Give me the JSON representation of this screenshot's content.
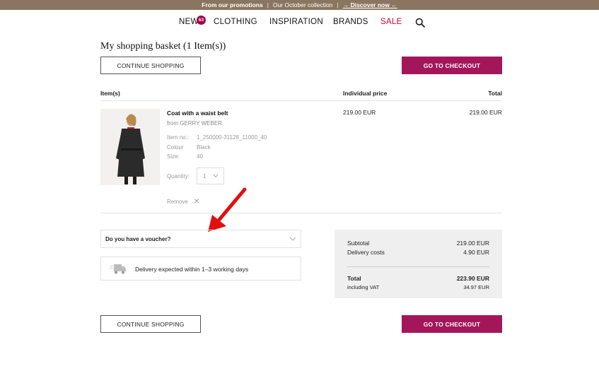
{
  "promo": {
    "part1": "From our promotions",
    "sep1": "|",
    "part2": "Our October collection",
    "sep2": "|",
    "link": "→ Discover now ←"
  },
  "nav": {
    "items": [
      {
        "label": "NEW"
      },
      {
        "label": "CLOTHING"
      },
      {
        "label": "INSPIRATION"
      },
      {
        "label": "BRANDS"
      },
      {
        "label": "SALE"
      }
    ],
    "new_badge": "63",
    "sale_color": "#d4002a"
  },
  "basket": {
    "title": "My shopping basket (1 Item(s))",
    "continue_label": "CONTINUE SHOPPING",
    "checkout_label": "GO TO CHECKOUT",
    "accent_color": "#a3175a"
  },
  "table": {
    "headers": {
      "items": "Item(s)",
      "individual_price": "Individual price",
      "total": "Total"
    }
  },
  "item": {
    "name": "Coat with a waist belt",
    "brand": "from GERRY WEBER",
    "specs": [
      {
        "label": "Item no.:",
        "value": "1_250000-31128_11000_40"
      },
      {
        "label": "Colour",
        "value": "Black"
      },
      {
        "label": "Size:",
        "value": "40"
      }
    ],
    "quantity_label": "Quantity:",
    "quantity_value": "1",
    "remove_label": "Remove",
    "remove_icon": "✕",
    "individual_price": "219.00 EUR",
    "total": "219.00 EUR"
  },
  "voucher": {
    "label": "Do you have a voucher?"
  },
  "delivery": {
    "text": "Delivery expected within 1–3 working days",
    "icon": "truck-icon"
  },
  "summary": {
    "subtotal_label": "Subtotal",
    "subtotal_value": "219.00 EUR",
    "delivery_label": "Delivery costs",
    "delivery_value": "4.90 EUR",
    "total_label": "Total",
    "total_value": "223.90 EUR",
    "vat_label": "including VAT",
    "vat_value": "34.97 EUR"
  },
  "annotation": {
    "arrow_color": "#e01010"
  }
}
